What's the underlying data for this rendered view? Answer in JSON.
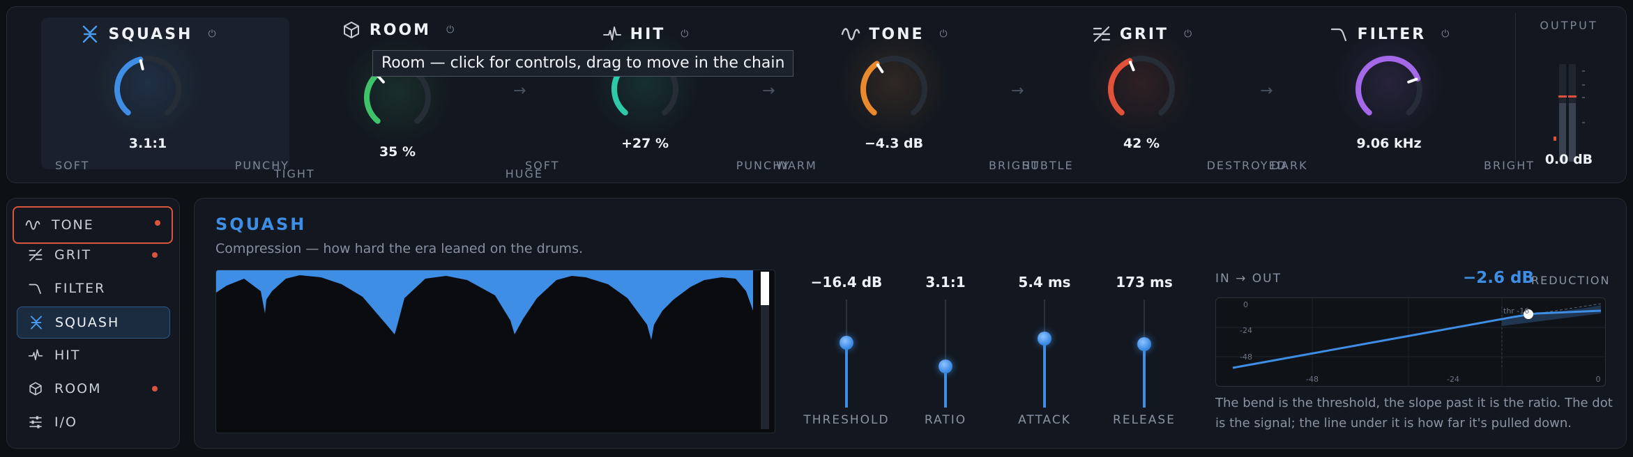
{
  "modules": [
    {
      "name": "SQUASH",
      "icon": "squash-icon",
      "value": "3.1:1",
      "low": "SOFT",
      "high": "PUNCHY",
      "level": 0.45,
      "color": "#3f8ee6",
      "active": true
    },
    {
      "name": "ROOM",
      "icon": "room-icon",
      "value": "35 %",
      "low": "TIGHT",
      "high": "HUGE",
      "level": 0.35,
      "color": "#3ec26a",
      "active": false
    },
    {
      "name": "HIT",
      "icon": "hit-icon",
      "value": "+27 %",
      "low": "SOFT",
      "high": "PUNCHY",
      "level": 0.6,
      "color": "#2ec9a6",
      "active": false
    },
    {
      "name": "TONE",
      "icon": "tone-icon",
      "value": "−4.3 dB",
      "low": "WARM",
      "high": "BRIGHT",
      "level": 0.38,
      "color": "#e98a2e",
      "active": false
    },
    {
      "name": "GRIT",
      "icon": "grit-icon",
      "value": "42 %",
      "low": "SUBTLE",
      "high": "DESTROYED",
      "level": 0.42,
      "color": "#e2513a",
      "active": false
    },
    {
      "name": "FILTER",
      "icon": "filter-icon",
      "value": "9.06 kHz",
      "low": "DARK",
      "high": "BRIGHT",
      "level": 0.75,
      "color": "#a468e8",
      "active": false
    }
  ],
  "tooltip": "Room — click for controls, drag to move in the chain",
  "output": {
    "label": "OUTPUT",
    "value": "0.0 dB"
  },
  "sidebar": {
    "items": [
      {
        "label": "TONE",
        "icon": "tone-icon",
        "dot": true,
        "state": "hover"
      },
      {
        "label": "GRIT",
        "icon": "grit-icon",
        "dot": true,
        "state": ""
      },
      {
        "label": "FILTER",
        "icon": "filter-icon",
        "dot": false,
        "state": ""
      },
      {
        "label": "SQUASH",
        "icon": "squash-icon",
        "dot": false,
        "state": "selected"
      },
      {
        "label": "HIT",
        "icon": "hit-icon",
        "dot": false,
        "state": ""
      },
      {
        "label": "ROOM",
        "icon": "room-icon",
        "dot": true,
        "state": ""
      },
      {
        "label": "I/O",
        "icon": "io-icon",
        "dot": false,
        "state": ""
      }
    ]
  },
  "detail": {
    "title": "SQUASH",
    "description": "Compression — how hard the era leaned on the drums.",
    "sliders": [
      {
        "label": "THRESHOLD",
        "value": "−16.4 dB",
        "level": 0.6
      },
      {
        "label": "RATIO",
        "value": "3.1:1",
        "level": 0.38
      },
      {
        "label": "ATTACK",
        "value": "5.4 ms",
        "level": 0.64
      },
      {
        "label": "RELEASE",
        "value": "173 ms",
        "level": 0.59
      }
    ],
    "io_label": "IN → OUT",
    "reduction_value": "−2.6 dB",
    "reduction_label": "REDUCTION",
    "graph": {
      "x_ticks": [
        "-48",
        "-24",
        "0"
      ],
      "y_ticks": [
        "0",
        "-24",
        "-48"
      ],
      "threshold_label": "thr -16"
    },
    "footnote": "The bend is the threshold, the slope past it is the ratio. The dot is the signal; the line under it is how far it's pulled down."
  }
}
